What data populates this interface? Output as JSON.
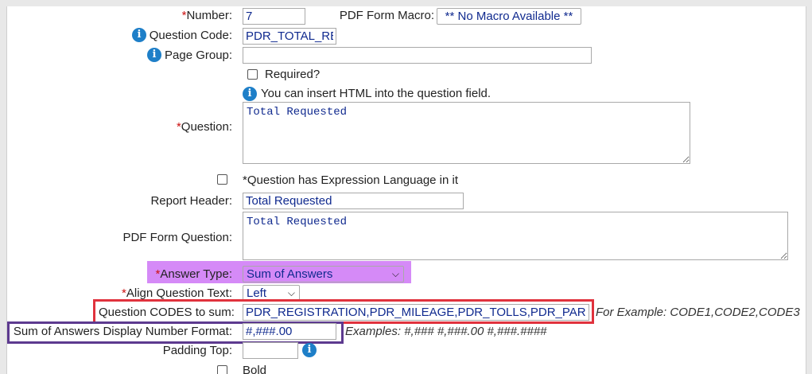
{
  "form": {
    "number": {
      "label": "Number:",
      "required_mark": "*",
      "value": "7"
    },
    "pdf_form_macro": {
      "label": "PDF Form Macro:",
      "value": "** No Macro Available **"
    },
    "question_code": {
      "label": "Question Code:",
      "value": "PDR_TOTAL_RE"
    },
    "page_group": {
      "label": "Page Group:",
      "value": ""
    },
    "required": {
      "label": "Required?"
    },
    "html_hint": "You can insert HTML into the question field.",
    "question": {
      "label": "Question:",
      "required_mark": "*",
      "value": "Total Requested"
    },
    "expression_language": {
      "required_mark": "*",
      "label": "Question has Expression Language in it"
    },
    "report_header": {
      "label": "Report Header:",
      "value": "Total Requested"
    },
    "pdf_form_question": {
      "label": "PDF Form Question:",
      "value": "Total Requested"
    },
    "answer_type": {
      "label": "Answer Type:",
      "required_mark": "*",
      "value": "Sum of Answers"
    },
    "align_question_text": {
      "label": "Align Question Text:",
      "required_mark": "*",
      "value": "Left"
    },
    "question_codes_to_sum": {
      "label": "Question CODES to sum:",
      "value": "PDR_REGISTRATION,PDR_MILEAGE,PDR_TOLLS,PDR_PARKING",
      "example": "For Example: CODE1,CODE2,CODE3"
    },
    "display_number_format": {
      "label": "Sum of Answers Display Number Format:",
      "value": "#,###.00",
      "example": "Examples: #,###   #,###.00   #,###.####"
    },
    "padding_top": {
      "label": "Padding Top:",
      "value": ""
    },
    "bold": {
      "label": "Bold"
    }
  },
  "icons": {
    "info": "info-icon",
    "chevron": "chevron-down-icon"
  },
  "colors": {
    "required": "#cc1111",
    "value_text": "#102a8f",
    "info_icon": "#1e7fc8",
    "answer_type_highlight": "#d58af7",
    "codes_highlight": "#e0323d",
    "format_highlight": "#5d3a8f"
  }
}
